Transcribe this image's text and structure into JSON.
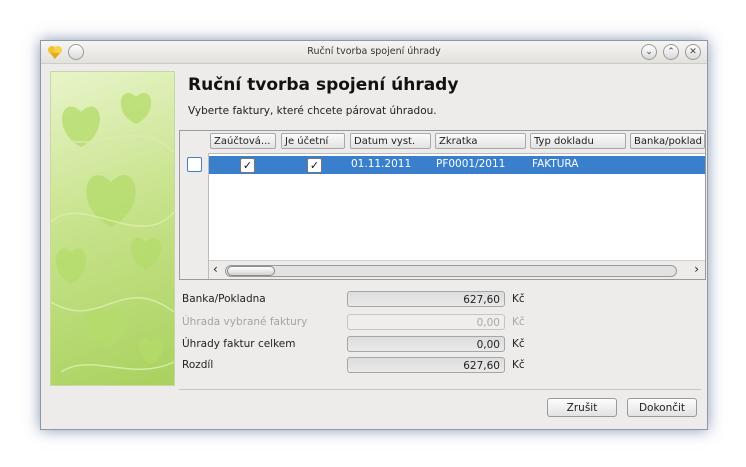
{
  "window": {
    "title": "Ruční tvorba spojení úhrady"
  },
  "page": {
    "heading": "Ruční tvorba spojení úhrady",
    "subtitle": "Vyberte faktury, které chcete párovat úhradou."
  },
  "table": {
    "columns": [
      "Zaúčtová...",
      "Je účetní",
      "Datum vyst.",
      "Zkratka",
      "Typ dokladu",
      "Banka/poklad"
    ],
    "rows": [
      {
        "selected": false,
        "zauctovano": true,
        "je_ucetni": true,
        "datum": "01.11.2011",
        "zkratka": "PF0001/2011",
        "typ": "FAKTURA",
        "banka": ""
      }
    ]
  },
  "summary": {
    "banka_label": "Banka/Pokladna",
    "banka_value": "627,60",
    "uhrada_label": "Úhrada vybrané faktury",
    "uhrada_value": "0,00",
    "celkem_label": "Úhrady faktur celkem",
    "celkem_value": "0,00",
    "rozdil_label": "Rozdíl",
    "rozdil_value": "627,60",
    "currency": "Kč"
  },
  "buttons": {
    "cancel": "Zrušit",
    "finish": "Dokončit"
  },
  "icons": {
    "app": "app-logo-icon",
    "menu": "window-menu-icon",
    "minimize": "minimize-icon",
    "maximize": "maximize-icon",
    "close": "close-icon"
  },
  "colors": {
    "selection": "#3a7fcb",
    "sidebar_green": "#a9d15e"
  }
}
